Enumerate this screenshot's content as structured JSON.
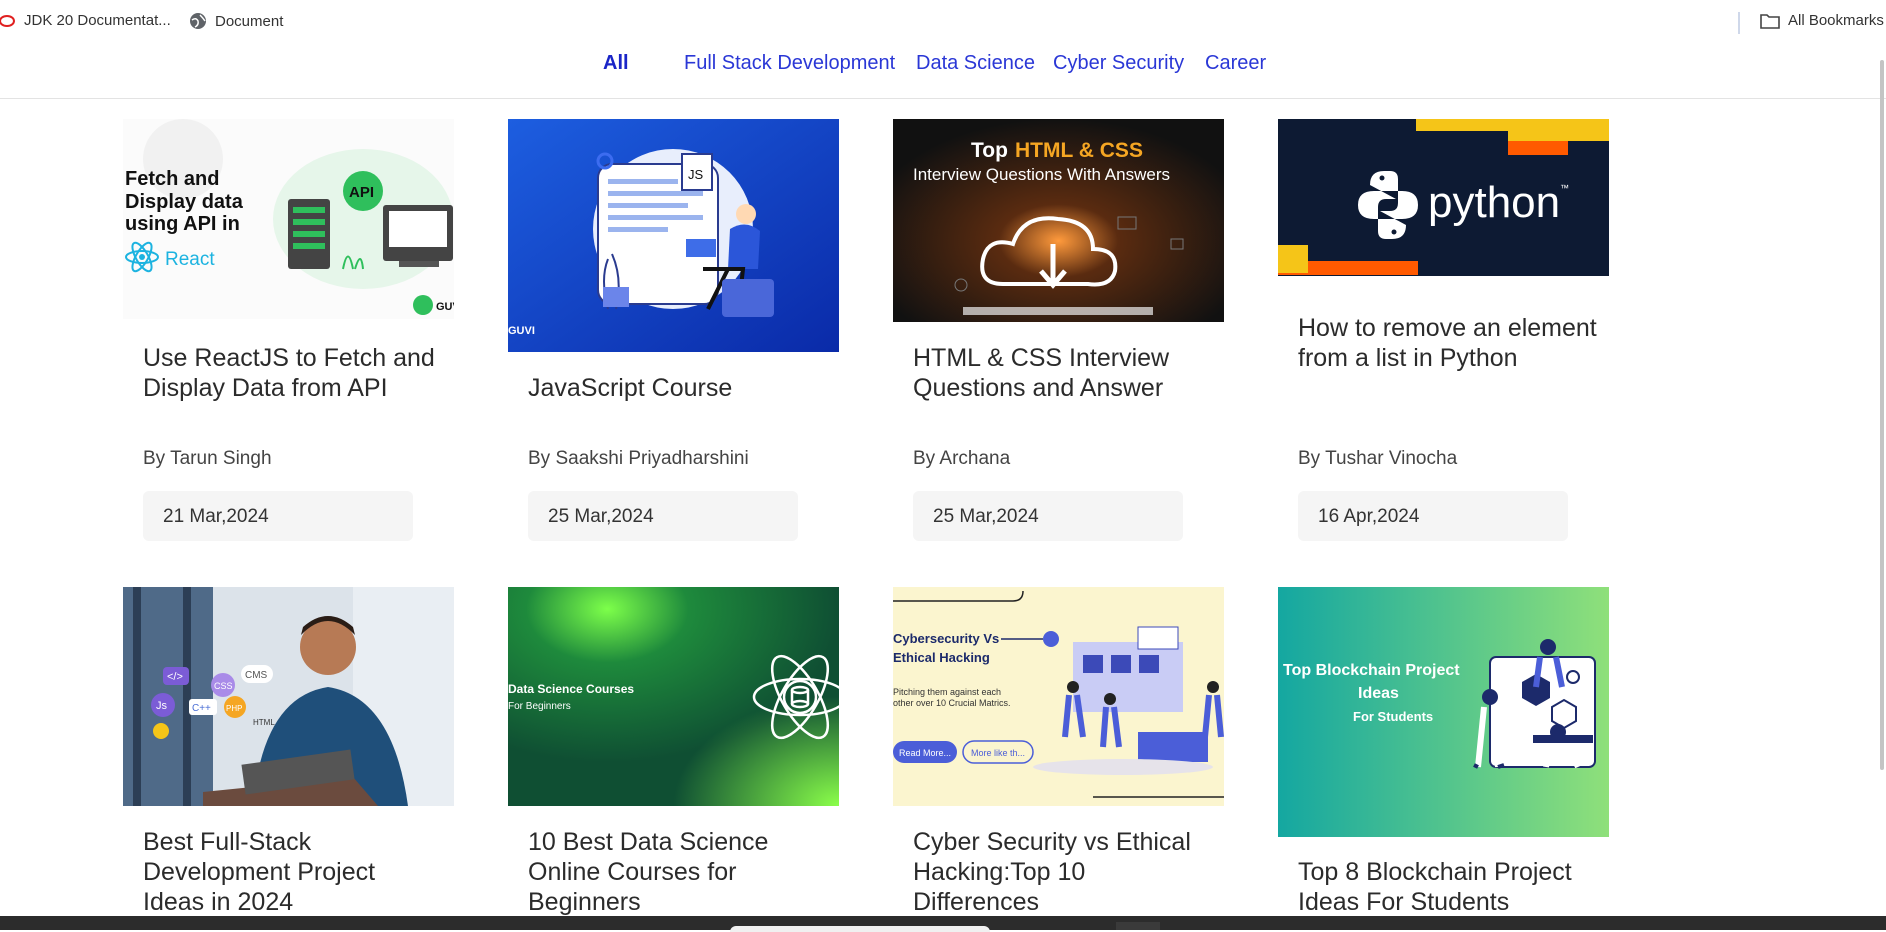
{
  "bookmarks": [
    {
      "label": "JDK 20 Documentat...",
      "icon": "oracle-icon"
    },
    {
      "label": "Document",
      "icon": "globe-icon"
    }
  ],
  "all_bookmarks": {
    "label": "All Bookmarks",
    "icon": "folder-icon"
  },
  "categories": [
    {
      "label": "All",
      "active": true
    },
    {
      "label": "Full Stack Development",
      "active": false
    },
    {
      "label": "Data Science",
      "active": false
    },
    {
      "label": "Cyber Security",
      "active": false
    },
    {
      "label": "Career",
      "active": false
    }
  ],
  "cards": [
    {
      "title": "Use ReactJS to Fetch and Display Data from API",
      "author": "By Tarun Singh",
      "date": "21 Mar,2024",
      "thumb": {
        "line1": "Fetch and",
        "line2": "Display data",
        "line3": "using API in",
        "react": "React",
        "api": "API",
        "brand": "GUVI"
      }
    },
    {
      "title": "JavaScript Course",
      "author": "By Saakshi Priyadharshini",
      "date": "25 Mar,2024",
      "thumb": {
        "js": "JS",
        "brand": "GUVI"
      }
    },
    {
      "title": "HTML & CSS Interview Questions and Answer",
      "author": "By Archana",
      "date": "25 Mar,2024",
      "thumb": {
        "top": "Top",
        "highlight": "HTML & CSS",
        "subtitle": "Interview Questions With Answers"
      }
    },
    {
      "title": "How to remove an element from a list in Python",
      "author": "By Tushar Vinocha",
      "date": "16 Apr,2024",
      "thumb": {
        "word": "python",
        "tm": "™"
      }
    },
    {
      "title": "Best Full-Stack Development Project Ideas in 2024",
      "thumb": {
        "tags": [
          "</>",
          "CMS",
          "CSS",
          "Js",
          "C++",
          "PHP",
          "HTML"
        ]
      }
    },
    {
      "title": "10 Best Data Science Online Courses for Beginners",
      "thumb": {
        "line1": "Data Science Courses",
        "line2": "For Beginners"
      }
    },
    {
      "title": "Cyber Security vs Ethical Hacking:Top 10 Differences",
      "thumb": {
        "line1": "Cybersecurity Vs",
        "line2": "Ethical Hacking",
        "desc1": "Pitching them against each",
        "desc2": "other over 10 Crucial Matrics.",
        "btn1": "Read More...",
        "btn2": "More like th..."
      }
    },
    {
      "title": "Top 8 Blockchain Project Ideas For Students",
      "thumb": {
        "line1": "Top Blockchain Project",
        "line2": "Ideas",
        "line3": "For Students"
      }
    }
  ],
  "colors": {
    "accent": "#2a37d6",
    "python_bg": "#0d1a33",
    "yellow": "#f5c518",
    "orange": "#ff5a00"
  }
}
